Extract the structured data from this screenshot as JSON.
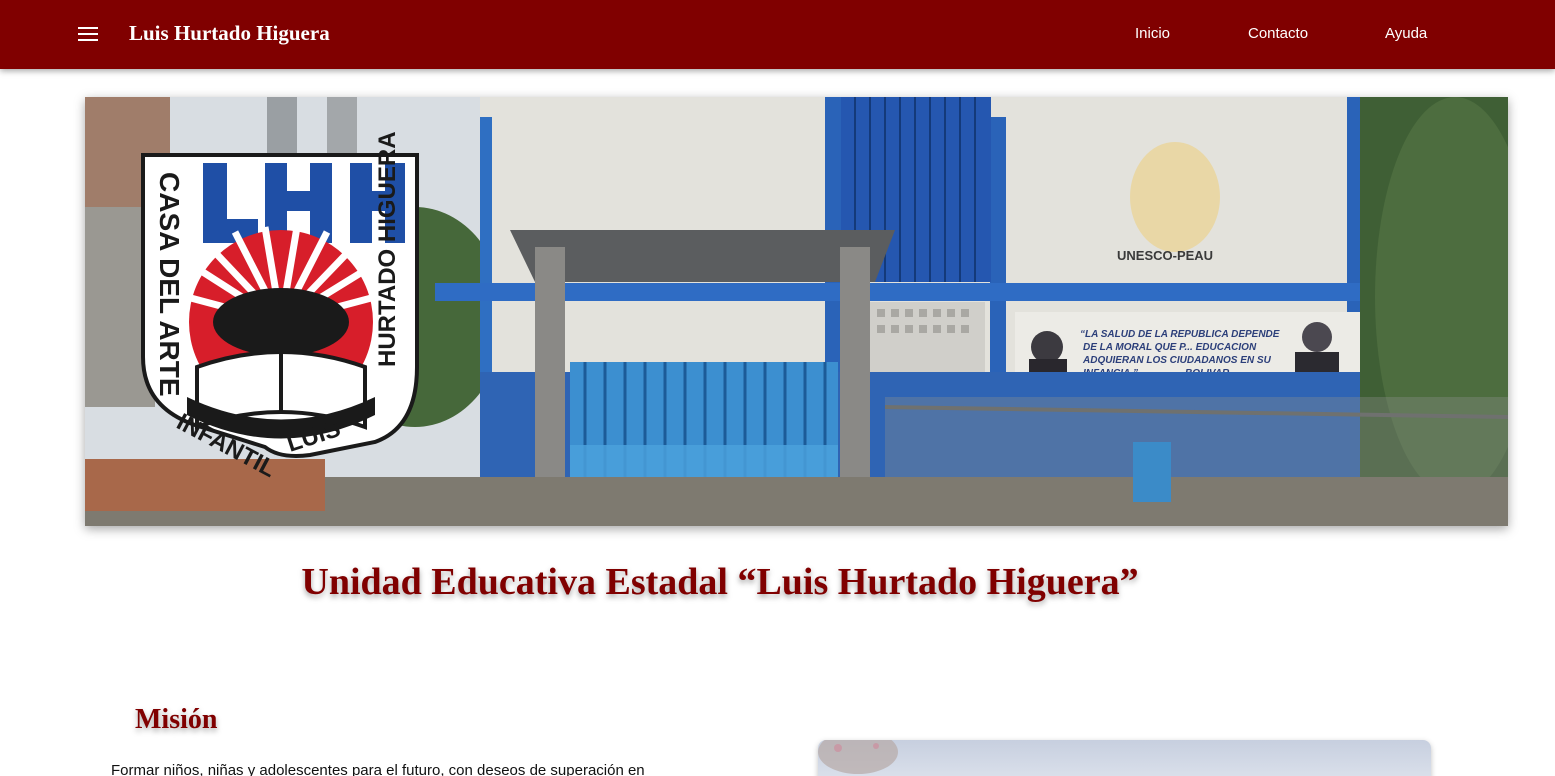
{
  "navbar": {
    "menu_icon": "hamburger-menu-icon",
    "brand": "Luis Hurtado Higuera",
    "links": [
      {
        "label": "Inicio"
      },
      {
        "label": "Contacto"
      },
      {
        "label": "Ayuda"
      }
    ],
    "background_color": "#800000"
  },
  "hero": {
    "logo": {
      "monogram": "LHH",
      "ring_text_left": "CASA DEL ARTE INFANTIL",
      "ring_text_right": "LUIS HURTADO HIGUERA"
    },
    "building_sign": "UNESCO-PEAU",
    "mural_text": "\"LA SALUD DE LA REPUBLICA DEPENDE DE LA MORAL QUE P... EDUCACION ADQUIERAN LOS CIUDADANOS EN SU INFANCIA.\" BOLIVAR"
  },
  "main": {
    "title": "Unidad Educativa Estadal “Luis Hurtado Higuera”",
    "mision": {
      "heading": "Misión",
      "text": "Formar niños, niñas y adolescentes para el futuro, con deseos de superación en"
    }
  },
  "colors": {
    "accent": "#800000",
    "background": "#ffffff"
  }
}
